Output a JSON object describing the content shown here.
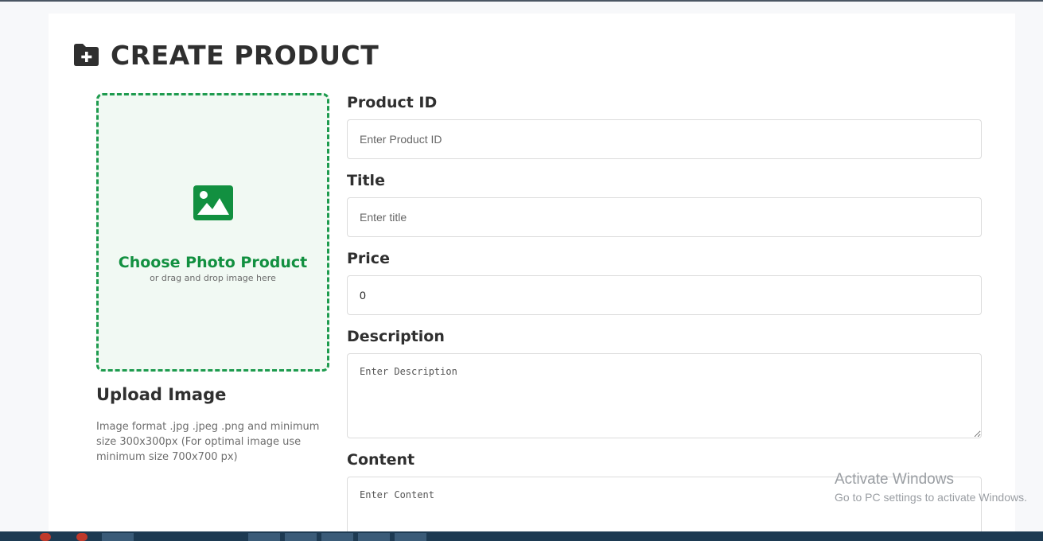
{
  "header": {
    "title": "CREATE PRODUCT",
    "icon": "folder-plus-icon"
  },
  "dropzone": {
    "icon": "image-icon",
    "title": "Choose Photo Product",
    "subtitle": "or drag and drop image here",
    "accent": "#129040"
  },
  "upload": {
    "title": "Upload Image",
    "help": "Image format .jpg .jpeg .png and minimum size 300x300px (For optimal image use minimum size 700x700 px)"
  },
  "form": {
    "product_id": {
      "label": "Product ID",
      "placeholder": "Enter Product ID",
      "value": ""
    },
    "title": {
      "label": "Title",
      "placeholder": "Enter title",
      "value": ""
    },
    "price": {
      "label": "Price",
      "placeholder": "",
      "value": "0"
    },
    "description": {
      "label": "Description",
      "placeholder": "Enter Description"
    },
    "content": {
      "label": "Content",
      "placeholder": "Enter Content"
    }
  },
  "watermark": {
    "title": "Activate Windows",
    "subtitle": "Go to PC settings to activate Windows."
  }
}
